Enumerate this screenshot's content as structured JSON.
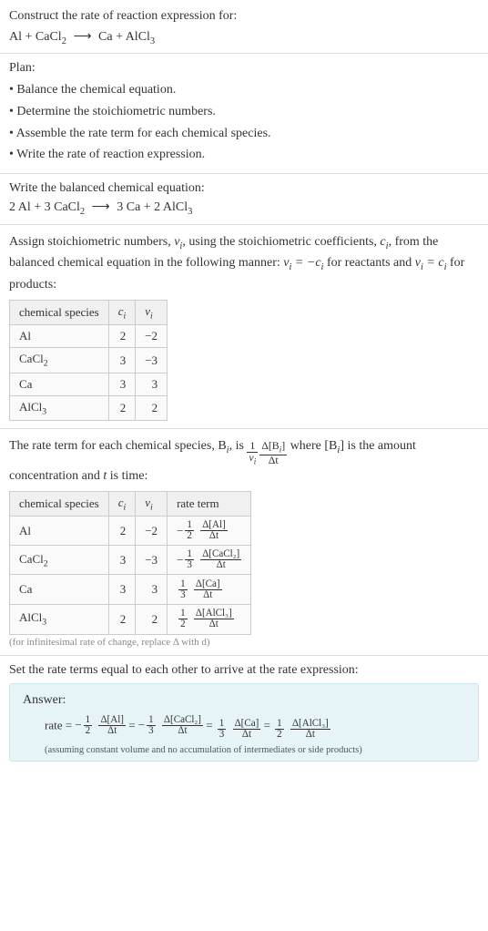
{
  "header": {
    "title": "Construct the rate of reaction expression for:",
    "equation_lhs": "Al + CaCl",
    "equation_rhs": "Ca + AlCl",
    "arrow": "⟶"
  },
  "plan": {
    "label": "Plan:",
    "items": [
      "Balance the chemical equation.",
      "Determine the stoichiometric numbers.",
      "Assemble the rate term for each chemical species.",
      "Write the rate of reaction expression."
    ]
  },
  "balanced": {
    "label": "Write the balanced chemical equation:",
    "lhs": "2 Al + 3 CaCl",
    "rhs": "3 Ca + 2 AlCl",
    "arrow": "⟶"
  },
  "stoich": {
    "intro_a": "Assign stoichiometric numbers, ",
    "intro_b": ", using the stoichiometric coefficients, ",
    "intro_c": ", from the balanced chemical equation in the following manner: ",
    "intro_d": " for reactants and ",
    "intro_e": " for products:",
    "nu_i": "ν",
    "c_i": "c",
    "eq1_lhs": "ν",
    "eq1_rhs": "−c",
    "eq2_lhs": "ν",
    "eq2_rhs": "c",
    "table": {
      "headers": [
        "chemical species",
        "c",
        "ν"
      ],
      "rows": [
        {
          "species": "Al",
          "c": "2",
          "nu": "−2"
        },
        {
          "species": "CaCl",
          "sub": "2",
          "c": "3",
          "nu": "−3"
        },
        {
          "species": "Ca",
          "c": "3",
          "nu": "3"
        },
        {
          "species": "AlCl",
          "sub": "3",
          "c": "2",
          "nu": "2"
        }
      ]
    }
  },
  "rate_term": {
    "intro_a": "The rate term for each chemical species, B",
    "intro_b": ", is ",
    "intro_c": " where [B",
    "intro_d": "] is the amount concentration and ",
    "intro_e": " is time:",
    "t": "t",
    "frac1_n": "1",
    "frac1_d": "ν",
    "frac2_n": "Δ[B",
    "frac2_d": "Δt",
    "table": {
      "headers": [
        "chemical species",
        "c",
        "ν",
        "rate term"
      ],
      "rows": [
        {
          "species": "Al",
          "c": "2",
          "nu": "−2",
          "sign": "−",
          "coef_n": "1",
          "coef_d": "2",
          "conc": "Δ[Al]",
          "dt": "Δt"
        },
        {
          "species": "CaCl",
          "sub": "2",
          "c": "3",
          "nu": "−3",
          "sign": "−",
          "coef_n": "1",
          "coef_d": "3",
          "conc": "Δ[CaCl₂]",
          "dt": "Δt"
        },
        {
          "species": "Ca",
          "c": "3",
          "nu": "3",
          "sign": "",
          "coef_n": "1",
          "coef_d": "3",
          "conc": "Δ[Ca]",
          "dt": "Δt"
        },
        {
          "species": "AlCl",
          "sub": "3",
          "c": "2",
          "nu": "2",
          "sign": "",
          "coef_n": "1",
          "coef_d": "2",
          "conc": "Δ[AlCl₃]",
          "dt": "Δt"
        }
      ]
    },
    "footnote": "(for infinitesimal rate of change, replace Δ with d)"
  },
  "final": {
    "label": "Set the rate terms equal to each other to arrive at the rate expression:"
  },
  "answer": {
    "label": "Answer:",
    "rate_label": "rate = ",
    "terms": [
      {
        "sign": "−",
        "coef_n": "1",
        "coef_d": "2",
        "conc": "Δ[Al]",
        "dt": "Δt"
      },
      {
        "sign": "−",
        "coef_n": "1",
        "coef_d": "3",
        "conc": "Δ[CaCl₂]",
        "dt": "Δt"
      },
      {
        "sign": "",
        "coef_n": "1",
        "coef_d": "3",
        "conc": "Δ[Ca]",
        "dt": "Δt"
      },
      {
        "sign": "",
        "coef_n": "1",
        "coef_d": "2",
        "conc": "Δ[AlCl₃]",
        "dt": "Δt"
      }
    ],
    "eq": " = ",
    "note": "(assuming constant volume and no accumulation of intermediates or side products)"
  },
  "chart_data": {
    "type": "table",
    "title": "Stoichiometric and rate terms for Al + CaCl2 → Ca + AlCl3",
    "balanced_equation": "2 Al + 3 CaCl2 → 3 Ca + 2 AlCl3",
    "species": [
      "Al",
      "CaCl2",
      "Ca",
      "AlCl3"
    ],
    "c_i": [
      2,
      3,
      3,
      2
    ],
    "nu_i": [
      -2,
      -3,
      3,
      2
    ],
    "rate_terms": [
      "-(1/2) Δ[Al]/Δt",
      "-(1/3) Δ[CaCl2]/Δt",
      "(1/3) Δ[Ca]/Δt",
      "(1/2) Δ[AlCl3]/Δt"
    ],
    "rate_expression": "rate = -(1/2) Δ[Al]/Δt = -(1/3) Δ[CaCl2]/Δt = (1/3) Δ[Ca]/Δt = (1/2) Δ[AlCl3]/Δt"
  }
}
